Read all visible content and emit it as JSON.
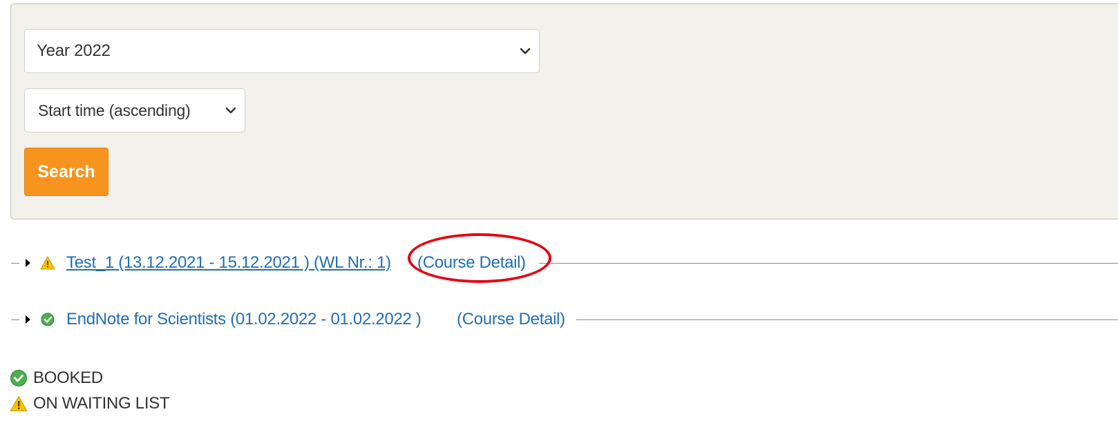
{
  "filters": {
    "year_select": {
      "value": "Year 2022"
    },
    "sort_select": {
      "value": "Start time (ascending)"
    },
    "search_label": "Search"
  },
  "courses": [
    {
      "status_icon": "warning-icon",
      "title": "Test_1 (13.12.2021 - 15.12.2021 ) (WL Nr.: 1)",
      "detail_label": "(Course Detail)"
    },
    {
      "status_icon": "check-circle-icon",
      "title": "EndNote for Scientists (01.02.2022 - 01.02.2022 )",
      "detail_label": "(Course Detail)"
    }
  ],
  "legend": {
    "booked": {
      "icon": "check-circle-icon",
      "label": "BOOKED"
    },
    "waiting": {
      "icon": "warning-icon",
      "label": "ON WAITING LIST"
    }
  },
  "colors": {
    "accent_orange": "#f7941d",
    "link_blue": "#1f6fb5",
    "annotation_red": "#e30613",
    "booked_green": "#4caf50",
    "warning_yellow": "#f5c400"
  }
}
